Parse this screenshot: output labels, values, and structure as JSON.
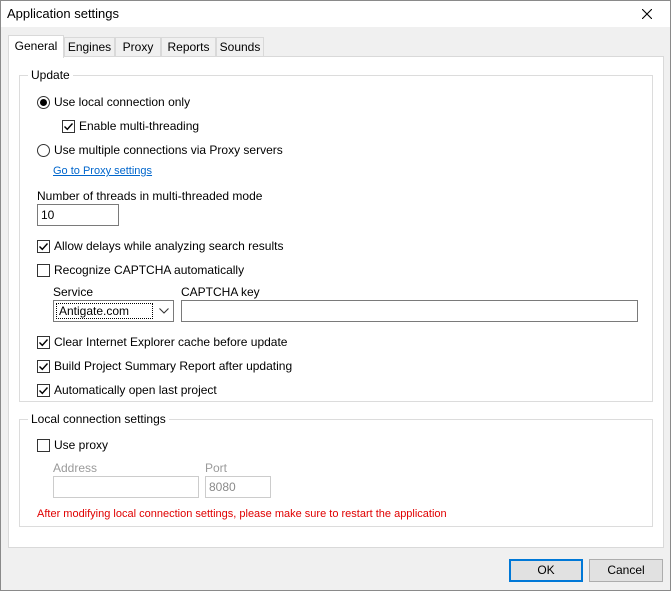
{
  "window": {
    "title": "Application settings"
  },
  "tabs": [
    {
      "label": "General"
    },
    {
      "label": "Engines"
    },
    {
      "label": "Proxy"
    },
    {
      "label": "Reports"
    },
    {
      "label": "Sounds"
    }
  ],
  "update": {
    "title": "Update",
    "use_local_label": "Use local connection only",
    "use_local_selected": true,
    "multithreading_label": "Enable multi-threading",
    "multithreading_checked": true,
    "use_proxy_servers_label": "Use multiple connections via Proxy servers",
    "use_proxy_servers_selected": false,
    "proxy_link": "Go to Proxy settings",
    "threads_label": "Number of threads in multi-threaded mode",
    "threads_value": "10",
    "allow_delays_label": "Allow delays while analyzing search results",
    "allow_delays_checked": true,
    "captcha_label": "Recognize CAPTCHA automatically",
    "captcha_checked": false,
    "service_label": "Service",
    "service_value": "Antigate.com",
    "captcha_key_label": "CAPTCHA key",
    "captcha_key_value": "",
    "clear_cache_label": "Clear Internet Explorer cache before update",
    "clear_cache_checked": true,
    "build_report_label": "Build Project Summary Report after updating",
    "build_report_checked": true,
    "open_last_label": "Automatically open last project",
    "open_last_checked": true
  },
  "local": {
    "title": "Local connection settings",
    "use_proxy_label": "Use proxy",
    "use_proxy_checked": false,
    "address_label": "Address",
    "address_value": "",
    "port_label": "Port",
    "port_value": "8080",
    "warning": "After modifying local connection settings, please make sure to restart the application"
  },
  "buttons": {
    "ok": "OK",
    "cancel": "Cancel"
  }
}
